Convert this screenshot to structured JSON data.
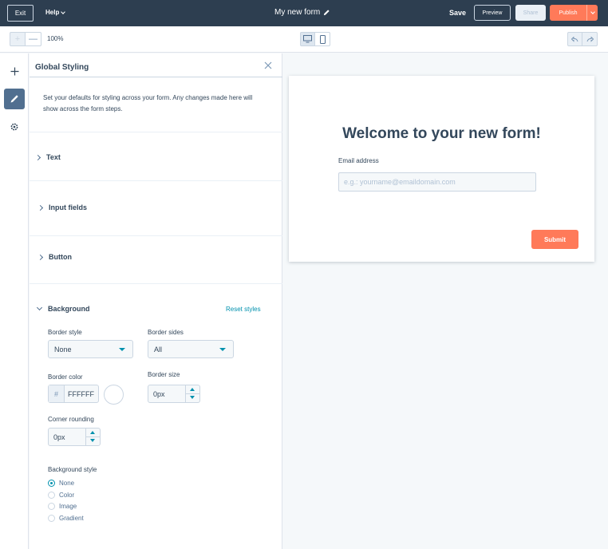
{
  "topbar": {
    "exit_label": "Exit",
    "help_label": "Help",
    "form_title": "My new form",
    "save_label": "Save",
    "preview_label": "Preview",
    "share_label": "Share",
    "publish_label": "Publish"
  },
  "toolbar": {
    "zoom_in": "+",
    "zoom_out": "—",
    "zoom_level": "100%"
  },
  "panel": {
    "title": "Global Styling",
    "description": "Set your defaults for styling across your form. Any changes made here will show across the form steps.",
    "sections": [
      {
        "label": "Text",
        "expanded": false
      },
      {
        "label": "Input fields",
        "expanded": false
      },
      {
        "label": "Button",
        "expanded": false
      },
      {
        "label": "Background",
        "expanded": true
      }
    ],
    "reset_label": "Reset styles",
    "background": {
      "border_style_label": "Border style",
      "border_style_value": "None",
      "border_sides_label": "Border sides",
      "border_sides_value": "All",
      "border_color_label": "Border color",
      "border_color_hash": "#",
      "border_color_value": "FFFFFF",
      "border_size_label": "Border size",
      "border_size_value": "0px",
      "corner_rounding_label": "Corner rounding",
      "corner_rounding_value": "0px",
      "background_style_label": "Background style",
      "background_style_options": [
        "None",
        "Color",
        "Image",
        "Gradient"
      ],
      "background_style_selected": "None"
    }
  },
  "canvas": {
    "heading": "Welcome to your new form!",
    "email_label": "Email address",
    "email_placeholder": "e.g.: yourname@emaildomain.com",
    "submit_label": "Submit"
  },
  "colors": {
    "topbar_bg": "#2d3e50",
    "accent_orange": "#ff7a59",
    "link_teal": "#0091ae",
    "text_dark": "#33475b"
  }
}
